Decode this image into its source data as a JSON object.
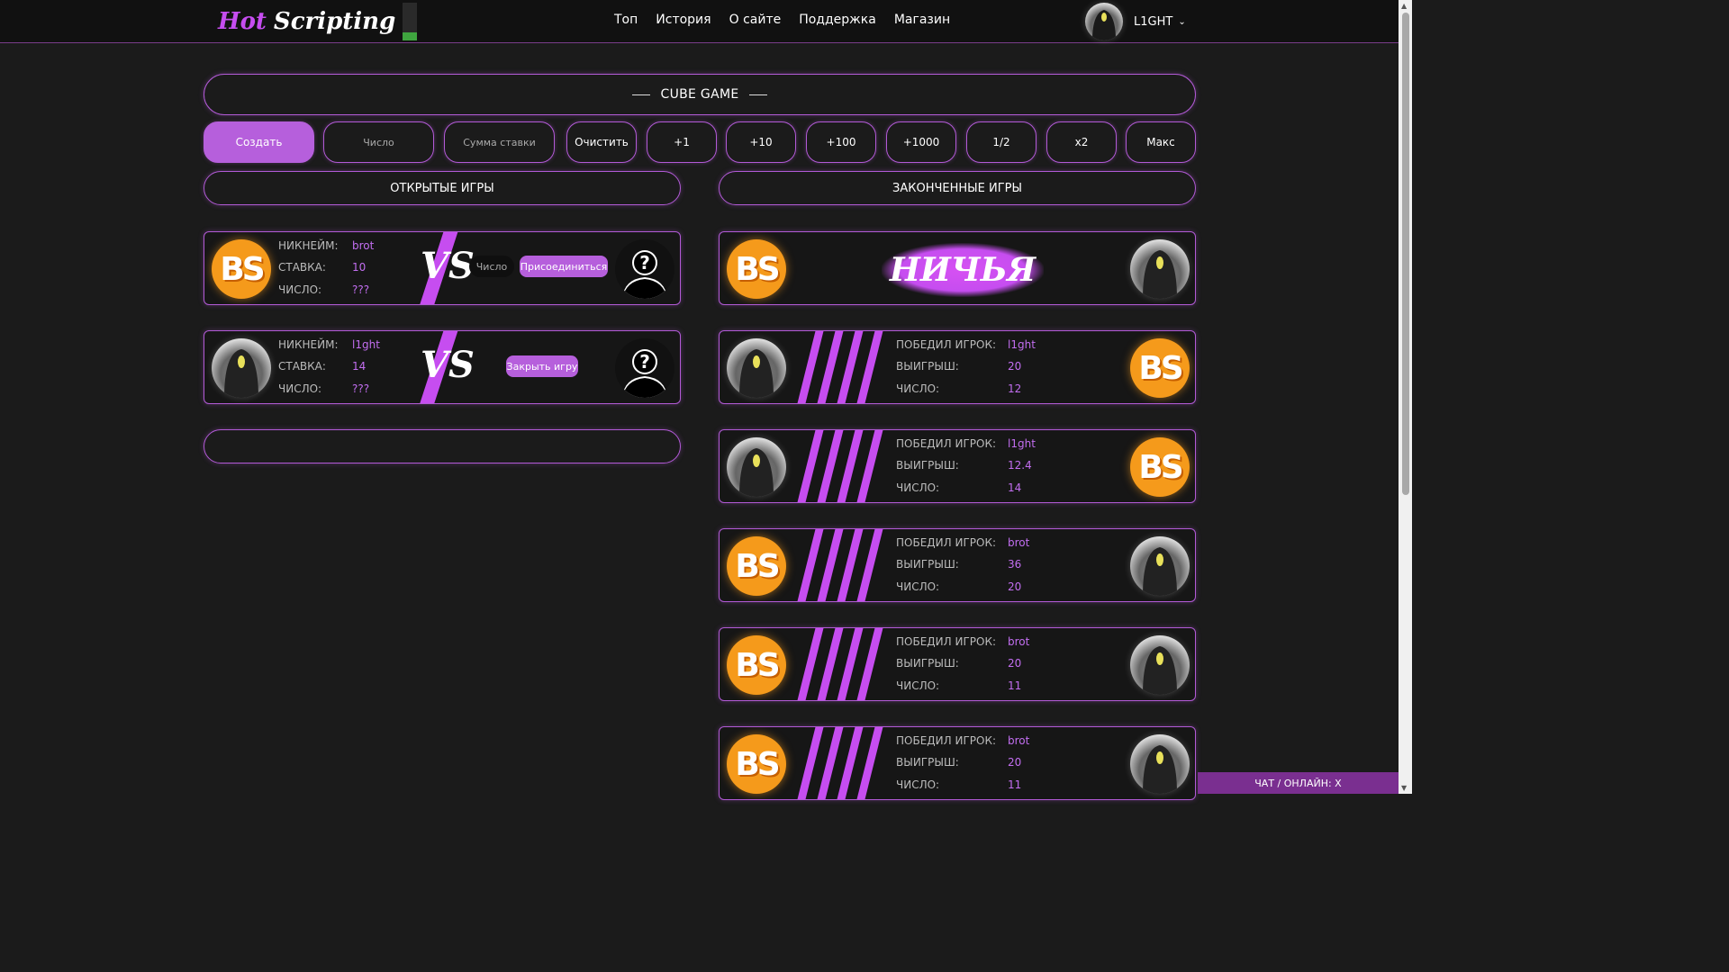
{
  "header": {
    "logo_hot": "Hot",
    "logo_scripting": "Scripting",
    "nav": [
      "Топ",
      "История",
      "О сайте",
      "Поддержка",
      "Магазин"
    ],
    "user_name": "L1GHT"
  },
  "game_title": "CUBE GAME",
  "controls": {
    "create": "Создать",
    "number_placeholder": "Число",
    "bet_placeholder": "Сумма ставки",
    "clear": "Очистить",
    "plus1": "+1",
    "plus10": "+10",
    "plus100": "+100",
    "plus1000": "+1000",
    "half": "1/2",
    "double": "x2",
    "max": "Макс"
  },
  "open_games": {
    "title": "ОТКРЫТЫЕ ИГРЫ",
    "labels": {
      "nick": "НИКНЕЙМ:",
      "bet": "СТАВКА:",
      "number": "ЧИСЛО:"
    },
    "vs": "VS",
    "items": [
      {
        "avatar": "BS",
        "nick": "brot",
        "bet": "10",
        "number": "???",
        "chip": "Число",
        "action": "Присоединиться"
      },
      {
        "avatar": "hood",
        "nick": "l1ght",
        "bet": "14",
        "number": "???",
        "action": "Закрыть игру"
      }
    ]
  },
  "finished_games": {
    "title": "ЗАКОНЧЕННЫЕ ИГРЫ",
    "draw_text": "НИЧЬЯ",
    "labels": {
      "winner": "ПОБЕДИЛ ИГРОК:",
      "win": "ВЫИГРЫШ:",
      "number": "ЧИСЛО:"
    },
    "items": [
      {
        "winner": "l1ght",
        "win": "20",
        "number": "12"
      },
      {
        "winner": "l1ght",
        "win": "12.4",
        "number": "14"
      },
      {
        "winner": "brot",
        "win": "36",
        "number": "20"
      },
      {
        "winner": "brot",
        "win": "20",
        "number": "11"
      },
      {
        "winner": "brot",
        "win": "20",
        "number": "11"
      }
    ]
  },
  "chat": "ЧАТ / ОНЛАЙН: X"
}
